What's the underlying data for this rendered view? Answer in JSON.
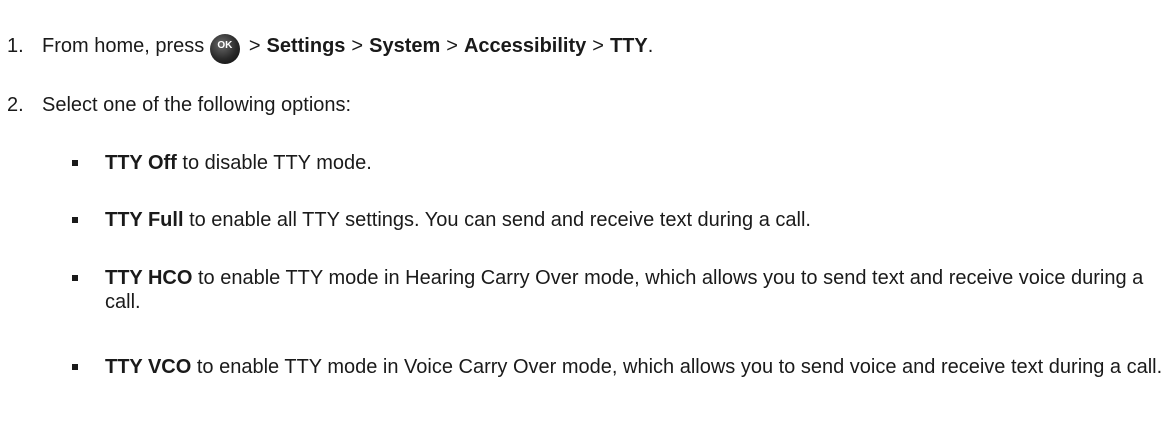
{
  "steps": [
    {
      "number": "1.",
      "prefix": "From home, press",
      "ok_button_label": "OK",
      "path_separator": ">",
      "path": [
        "Settings",
        "System",
        "Accessibility",
        "TTY"
      ],
      "suffix": "."
    },
    {
      "number": "2.",
      "text": "Select one of the following options:"
    }
  ],
  "options": [
    {
      "name": "TTY Off",
      "description": " to disable TTY mode."
    },
    {
      "name": "TTY Full",
      "description": " to enable all TTY settings. You can send and receive text during a call."
    },
    {
      "name": "TTY HCO",
      "description": " to enable TTY mode in Hearing Carry Over mode, which allows you to send text and receive voice during a call."
    },
    {
      "name": "TTY VCO",
      "description": " to enable TTY mode in Voice Carry Over mode, which allows you to send voice and receive text during a call."
    }
  ]
}
